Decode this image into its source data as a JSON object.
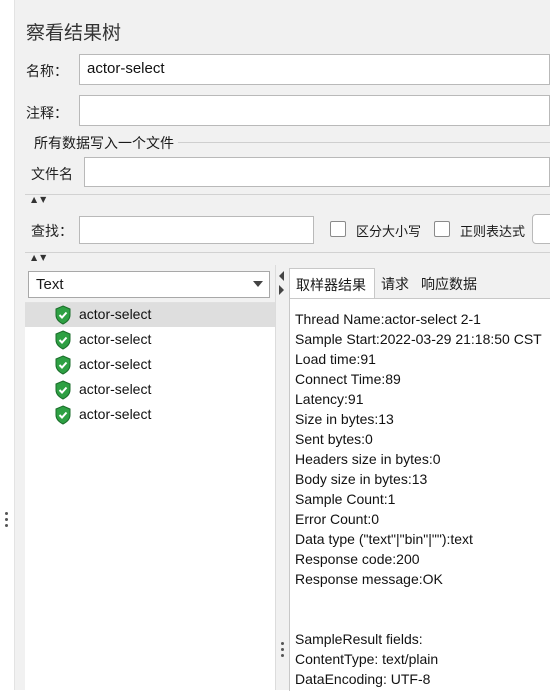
{
  "panel": {
    "title": "察看结果树"
  },
  "name_field": {
    "label": "名称：",
    "value": "actor-select"
  },
  "comment_field": {
    "label": "注释：",
    "value": ""
  },
  "file_group": {
    "title": "所有数据写入一个文件",
    "filename_label": "文件名",
    "filename_value": ""
  },
  "search": {
    "label": "查找：",
    "value": "",
    "case_sensitive_label": "区分大小写",
    "regex_label": "正则表达式"
  },
  "renderer": {
    "selected": "Text"
  },
  "tree_items": [
    {
      "label": "actor-select",
      "status": "success",
      "selected": true
    },
    {
      "label": "actor-select",
      "status": "success",
      "selected": false
    },
    {
      "label": "actor-select",
      "status": "success",
      "selected": false
    },
    {
      "label": "actor-select",
      "status": "success",
      "selected": false
    },
    {
      "label": "actor-select",
      "status": "success",
      "selected": false
    }
  ],
  "tabs": [
    {
      "label": "取样器结果",
      "active": true
    },
    {
      "label": "请求",
      "active": false
    },
    {
      "label": "响应数据",
      "active": false
    }
  ],
  "sampler_result": [
    "Thread Name:actor-select 2-1",
    "Sample Start:2022-03-29 21:18:50 CST",
    "Load time:91",
    "Connect Time:89",
    "Latency:91",
    "Size in bytes:13",
    "Sent bytes:0",
    "Headers size in bytes:0",
    "Body size in bytes:13",
    "Sample Count:1",
    "Error Count:0",
    "Data type (\"text\"|\"bin\"|\"\"):text",
    "Response code:200",
    "Response message:OK",
    "",
    "",
    "SampleResult fields:",
    "ContentType: text/plain",
    "DataEncoding: UTF-8"
  ],
  "colors": {
    "success_icon": "#2ea043",
    "panel_bg": "#f1f1f1"
  }
}
